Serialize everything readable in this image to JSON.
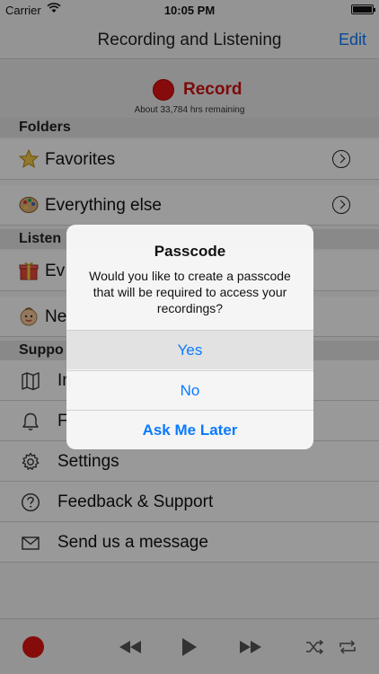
{
  "status": {
    "carrier": "Carrier",
    "time": "10:05 PM"
  },
  "nav": {
    "title": "Recording and Listening",
    "edit": "Edit"
  },
  "record": {
    "label": "Record",
    "remaining": "About 33,784 hrs remaining"
  },
  "folders": {
    "header": "Folders",
    "items": [
      {
        "label": "Favorites",
        "icon": "star-icon"
      },
      {
        "label": "Everything else",
        "icon": "palette-icon"
      }
    ]
  },
  "listen": {
    "header": "Listen",
    "items": [
      {
        "label": "Ev",
        "icon": "gift-icon"
      },
      {
        "label": "Ne",
        "icon": "baby-icon"
      }
    ]
  },
  "support": {
    "header": "Suppo",
    "items": [
      {
        "label": "In",
        "icon": "map-icon"
      },
      {
        "label": "F",
        "icon": "bell-icon"
      },
      {
        "label": "Settings",
        "icon": "gear-icon"
      },
      {
        "label": "Feedback & Support",
        "icon": "question-icon"
      },
      {
        "label": "Send us a message",
        "icon": "envelope-icon"
      }
    ]
  },
  "alert": {
    "title": "Passcode",
    "message": "Would you like to create a passcode that will be required to access your recordings?",
    "buttons": {
      "yes": "Yes",
      "no": "No",
      "later": "Ask Me Later"
    }
  },
  "colors": {
    "accent": "#0a7aff",
    "record": "#e01414"
  }
}
